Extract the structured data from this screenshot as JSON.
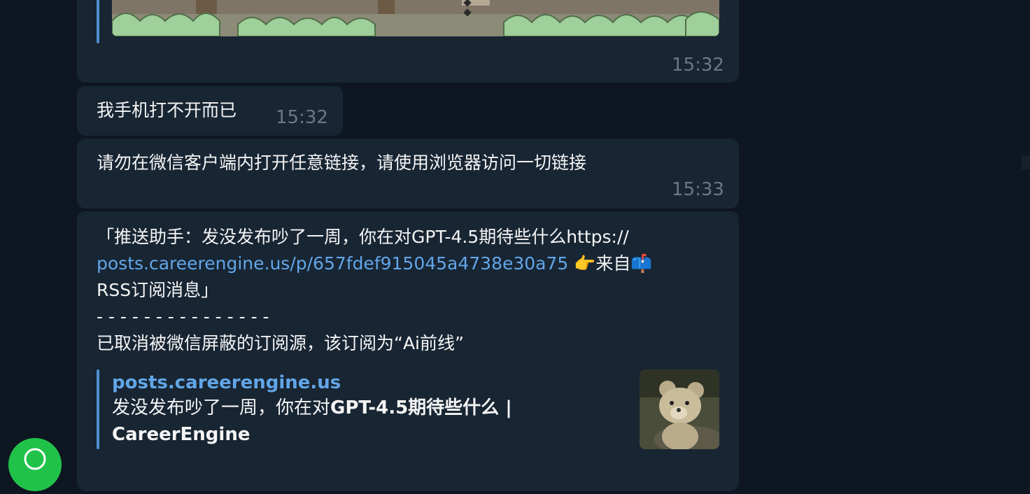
{
  "messages": [
    {
      "kind": "image",
      "time": "15:32",
      "image_icon": "pixel-game-screenshot"
    },
    {
      "kind": "text",
      "text": "我手机打不开而已",
      "time": "15:32"
    },
    {
      "kind": "text",
      "text": "请勿在微信客户端内打开任意链接，请使用浏览器访问一切链接",
      "time": "15:33"
    },
    {
      "kind": "link_post",
      "line1": "「推送助手：发没发布吵了一周，你在对GPT-4.5期待些什么https://",
      "link": "posts.careerengine.us/p/657fdef915045a4738e30a75",
      "after_link": " 👉来自📫",
      "line3": "RSS订阅消息」",
      "divider": "- - - - - - - - - - - - - - -",
      "line5": "已取消被微信屏蔽的订阅源，该订阅为“Ai前线”",
      "preview": {
        "site": "posts.careerengine.us",
        "desc_prefix": "发没发布吵了一周，你在对",
        "desc_bold": "GPT-4.5期待些什么 |",
        "desc_line2": "CareerEngine",
        "thumb_icon": "teddy-bear-photo"
      }
    }
  ],
  "colors": {
    "background": "#0e1621",
    "bubble": "#182533",
    "link": "#62a6e8",
    "time": "#6c7883",
    "fab": "#21c24a"
  },
  "fab_icon": "whatsapp-icon"
}
